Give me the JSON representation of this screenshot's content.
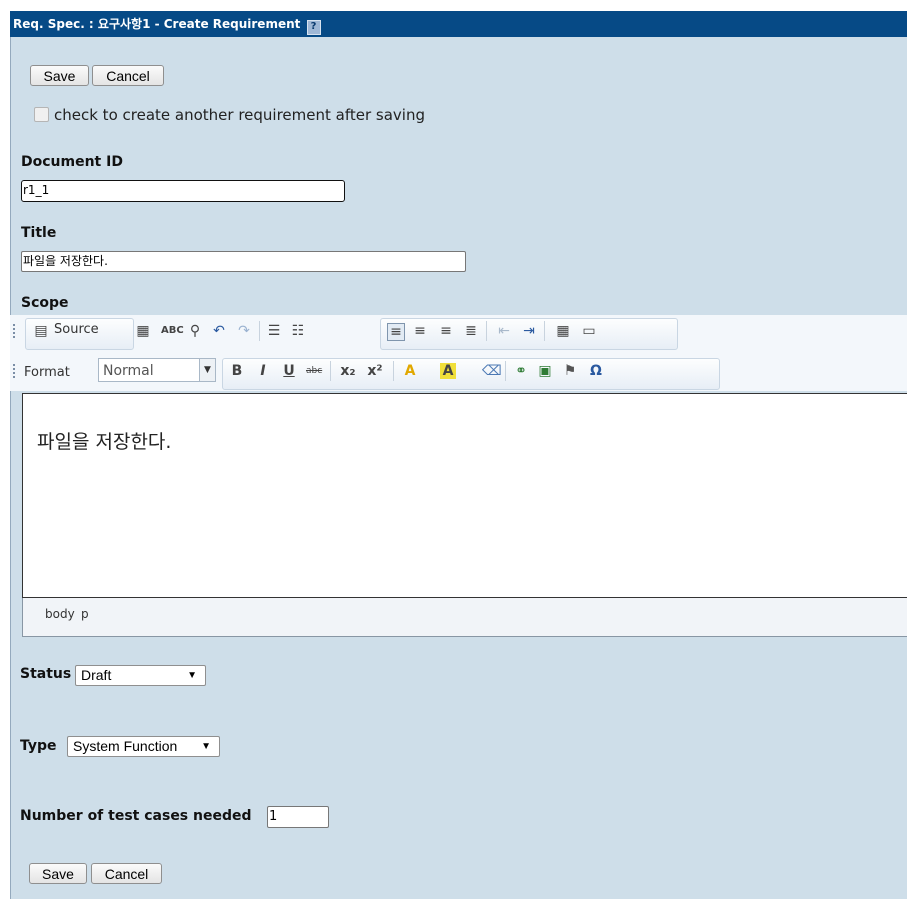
{
  "window": {
    "title": "Req. Spec. : 요구사항1 - Create Requirement",
    "help_icon": "?"
  },
  "actions": {
    "save_label": "Save",
    "cancel_label": "Cancel"
  },
  "create_another": {
    "label": "check to create another requirement after saving",
    "checked": false
  },
  "fields": {
    "document_id": {
      "label": "Document ID",
      "value": "r1_1"
    },
    "title": {
      "label": "Title",
      "value": "파일을 저장한다."
    },
    "scope": {
      "label": "Scope"
    }
  },
  "editor": {
    "toolbar_row1": {
      "source_label": "Source",
      "icons": [
        "source-icon",
        "templates-icon",
        "spellcheck-icon",
        "find-icon",
        "undo-icon",
        "redo-icon",
        "numbered-list-icon",
        "bulleted-list-icon",
        "align-left-icon",
        "align-center-icon",
        "align-right-icon",
        "justify-icon",
        "outdent-icon",
        "indent-icon",
        "table-icon",
        "horizontal-rule-icon"
      ]
    },
    "toolbar_row2": {
      "format_label": "Format",
      "format_value": "Normal",
      "icons": [
        "bold-icon",
        "italic-icon",
        "underline-icon",
        "strikethrough-icon",
        "subscript-icon",
        "superscript-icon",
        "text-color-icon",
        "bg-color-icon",
        "remove-format-icon",
        "link-icon",
        "image-icon",
        "anchor-icon",
        "special-char-icon"
      ]
    },
    "content": "파일을 저장한다.",
    "path": [
      "body",
      "p"
    ]
  },
  "status": {
    "label": "Status",
    "value": "Draft"
  },
  "type": {
    "label": "Type",
    "value": "System Function"
  },
  "test_cases": {
    "label": "Number of test cases needed",
    "value": "1"
  }
}
